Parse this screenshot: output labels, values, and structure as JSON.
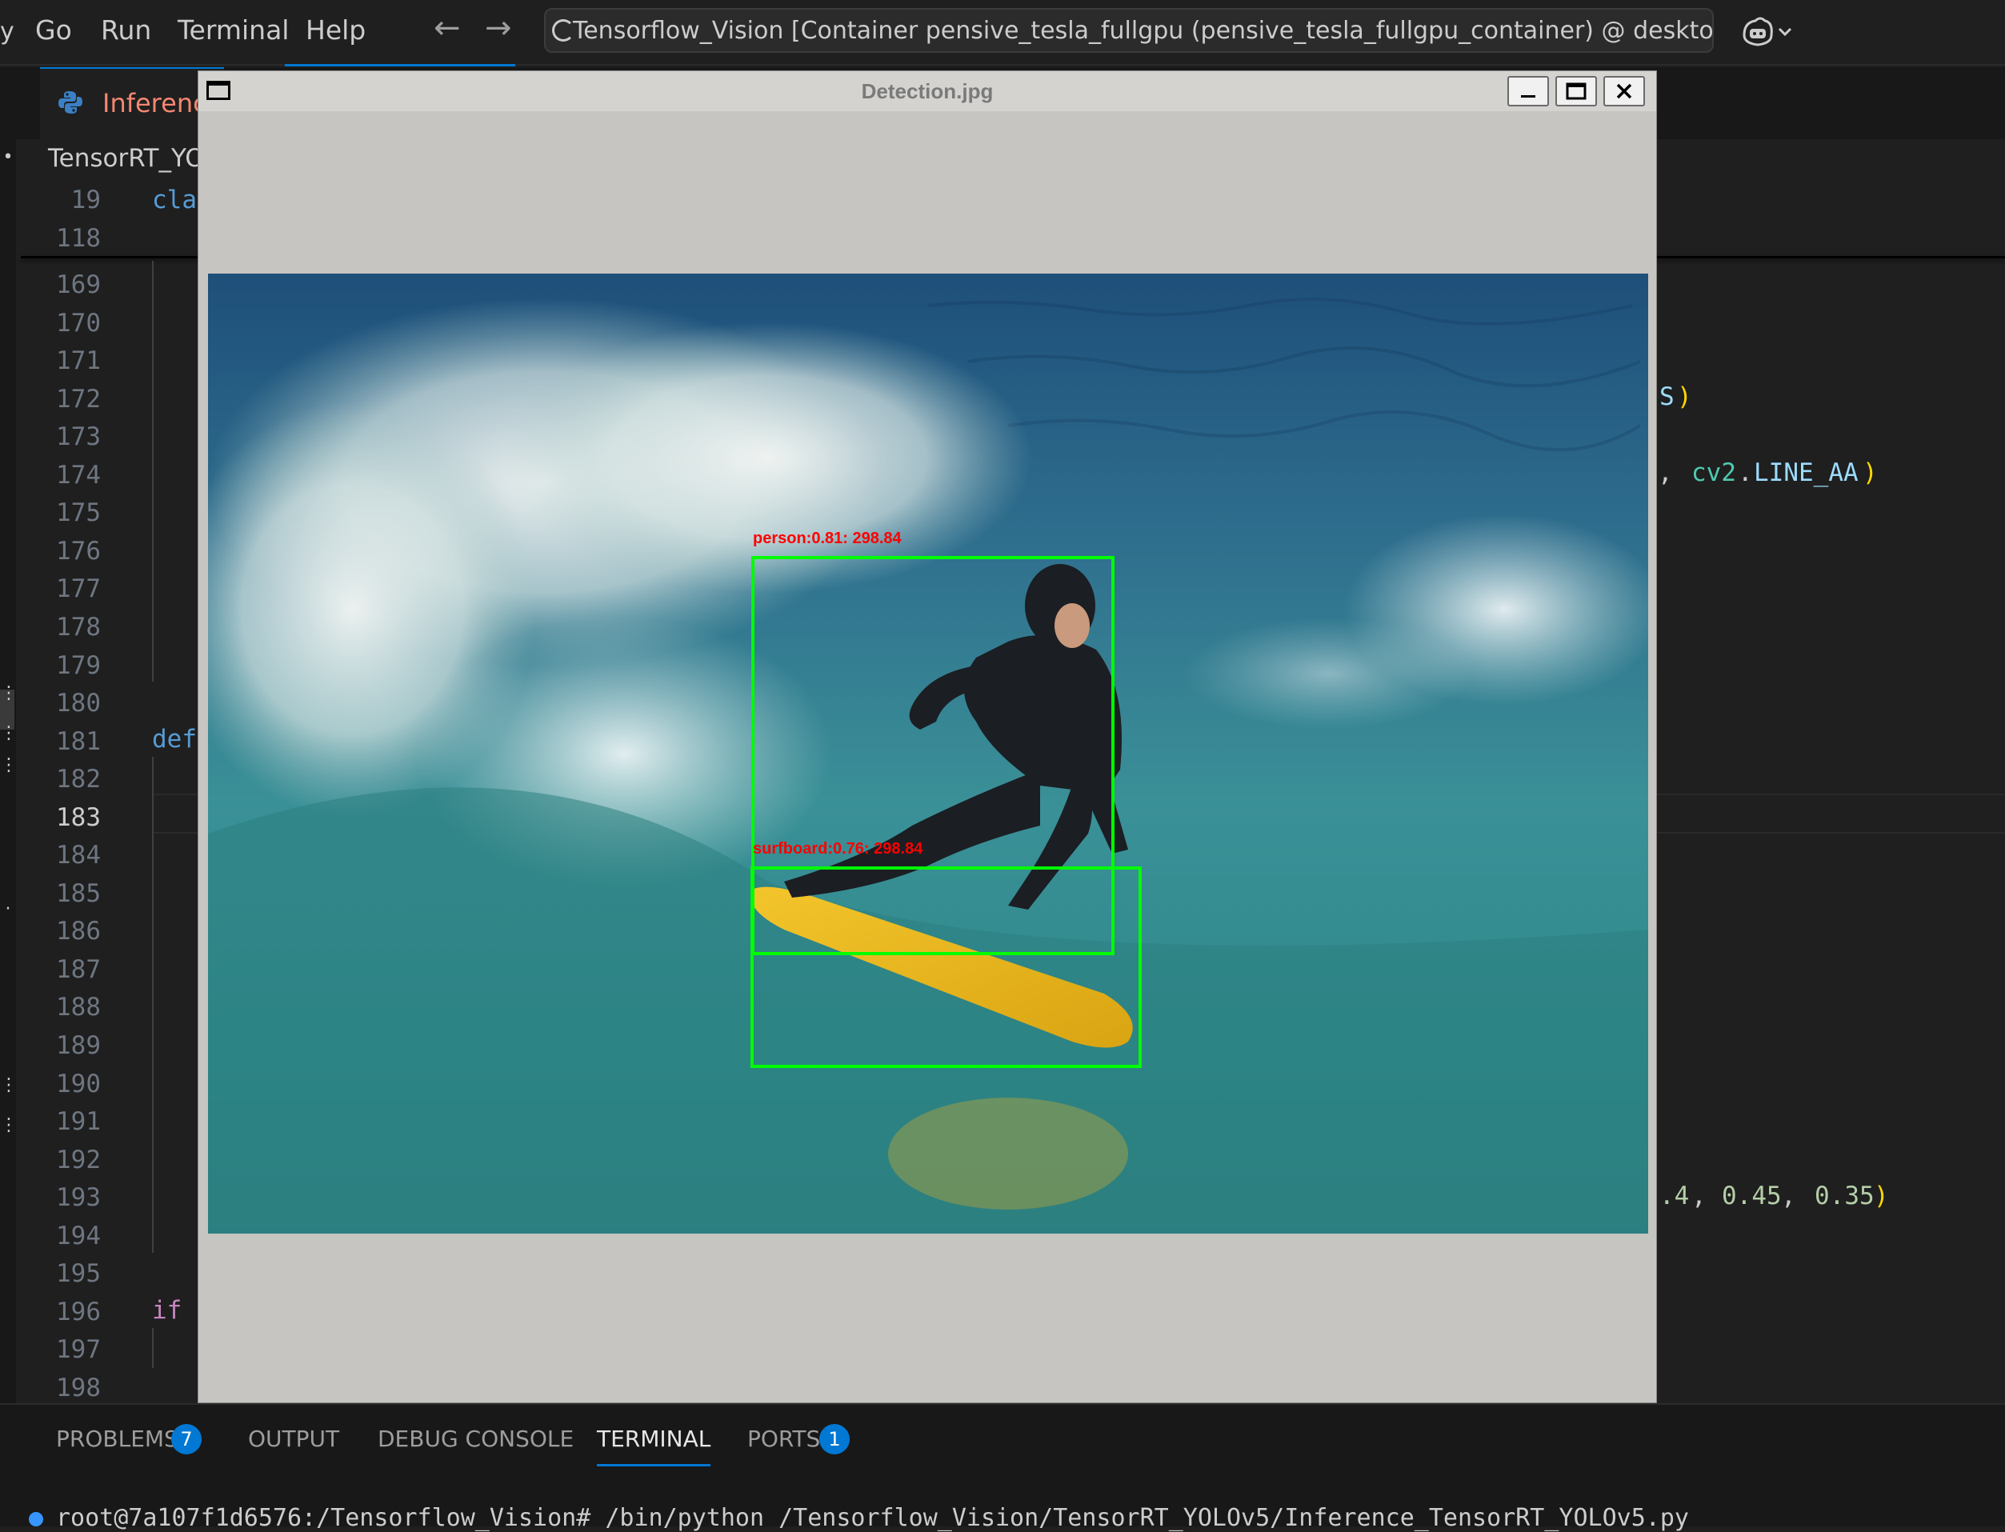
{
  "menubar": {
    "edge_char": "y",
    "items": [
      "Go",
      "Run",
      "Terminal",
      "Help"
    ],
    "back_arrow": "←",
    "forward_arrow": "→",
    "command_center": "Tensorflow_Vision [Container pensive_tesla_fullgpu (pensive_tesla_fullgpu_container) @ desktop-linux] [Ad...",
    "copilot_icon": "copilot-icon",
    "copilot_chevron": "chevron-down-icon"
  },
  "editor": {
    "tab_label": "Inference_",
    "tab_icon": "python-icon",
    "breadcrumb": "TensorRT_YOl",
    "sticky_lines": [
      {
        "num": "19",
        "code": "cla"
      },
      {
        "num": "118",
        "code": ""
      }
    ],
    "line_numbers": [
      "169",
      "170",
      "171",
      "172",
      "173",
      "174",
      "175",
      "176",
      "177",
      "178",
      "179",
      "180",
      "181",
      "182",
      "183",
      "184",
      "185",
      "186",
      "187",
      "188",
      "189",
      "190",
      "191",
      "192",
      "193",
      "194",
      "195",
      "196",
      "197",
      "198"
    ],
    "current_line": "183",
    "code": {
      "line181": "def",
      "line196": "if",
      "line172_tail": "S",
      "line172_paren": ")",
      "line174_pre": ",",
      "line174_mod": "cv2",
      "line174_dot": ".",
      "line174_attr": "LINE_AA",
      "line174_paren": ")",
      "line193_a": ".4",
      "line193_comma1": ", ",
      "line193_b": "0.45",
      "line193_comma2": ", ",
      "line193_c": "0.35",
      "line193_paren": " )"
    }
  },
  "image_window": {
    "title": "Detection.jpg",
    "minimize": "minimize-icon",
    "maximize": "maximize-icon",
    "close": "close-icon",
    "detections": [
      {
        "label": "person:0.81: 298.84"
      },
      {
        "label": "surfboard:0.76: 298.84"
      }
    ],
    "colors": {
      "box": "#00ff00",
      "label": "#ff0000"
    }
  },
  "panel": {
    "tabs": [
      {
        "label": "PROBLEMS",
        "badge": "7"
      },
      {
        "label": "OUTPUT"
      },
      {
        "label": "DEBUG CONSOLE"
      },
      {
        "label": "TERMINAL",
        "active": true
      },
      {
        "label": "PORTS",
        "badge": "1"
      }
    ],
    "terminal_line": "root@7a107f1d6576:/Tensorflow_Vision# /bin/python /Tensorflow_Vision/TensorRT_YOLOv5/Inference_TensorRT_YOLOv5.py"
  },
  "colors": {
    "accent": "#0078d4",
    "editor_bg": "#1f1f1f",
    "tab_modified": "#f48771"
  }
}
